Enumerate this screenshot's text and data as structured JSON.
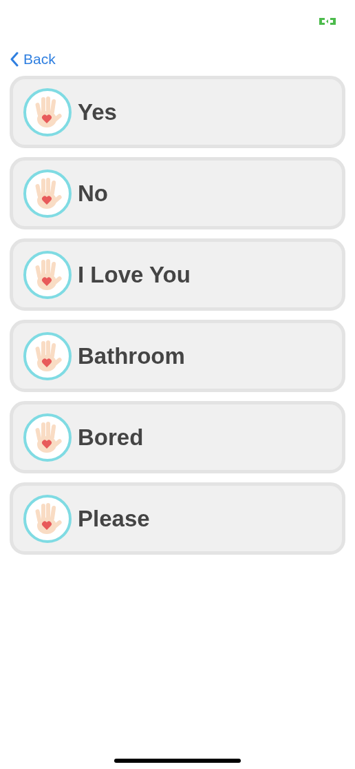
{
  "nav": {
    "back_label": "Back"
  },
  "phrases": [
    {
      "label": "Yes"
    },
    {
      "label": "No"
    },
    {
      "label": "I Love You"
    },
    {
      "label": "Bathroom"
    },
    {
      "label": "Bored"
    },
    {
      "label": "Please"
    }
  ]
}
